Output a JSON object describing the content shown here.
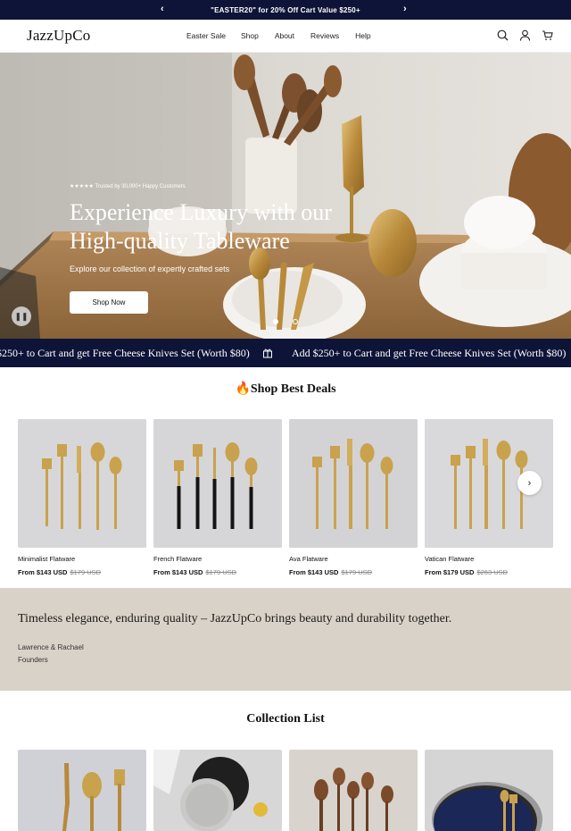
{
  "announcement": {
    "text": "\"EASTER20\" for 20% Off Cart Value $250+",
    "prev_icon": "chevron-left-icon",
    "next_icon": "chevron-right-icon"
  },
  "header": {
    "logo": "JazzUpCo",
    "nav": [
      "Easter Sale",
      "Shop",
      "About",
      "Reviews",
      "Help"
    ],
    "icons": [
      "search-icon",
      "account-icon",
      "cart-icon"
    ]
  },
  "hero": {
    "trusted": "★★★★★ Trusted by 30,000+ Happy Customers",
    "title": "Experience Luxury with our High-quality Tableware",
    "subtitle": "Explore our collection of expertly crafted sets",
    "cta": "Shop Now",
    "slides": 2,
    "active_slide": 1
  },
  "marquee": {
    "text": "Add $250+ to Cart and get Free Cheese Knives Set (Worth $80)",
    "text_clipped": "$250+ to Cart and get Free Cheese Knives Set (Worth $80)",
    "icon": "gift-icon"
  },
  "deals": {
    "title": "🔥Shop Best Deals",
    "products": [
      {
        "name": "Minimalist Flatware",
        "price": "From $143 USD",
        "compare": "$179 USD",
        "handle": "gold"
      },
      {
        "name": "French Flatware",
        "price": "From $143 USD",
        "compare": "$179 USD",
        "handle": "black"
      },
      {
        "name": "Ava Flatware",
        "price": "From $143 USD",
        "compare": "$179 USD",
        "handle": "gold"
      },
      {
        "name": "Vatican Flatware",
        "price": "From $179 USD",
        "compare": "$263 USD",
        "handle": "gold"
      }
    ]
  },
  "quote": {
    "text": "Timeless elegance, enduring quality – JazzUpCo brings beauty and durability together.",
    "author": "Lawrence & Rachael",
    "role": "Founders"
  },
  "collections": {
    "title": "Collection List"
  },
  "colors": {
    "navy": "#0d1437",
    "beige": "#d9d2c8",
    "gold": "#c9a24e"
  }
}
